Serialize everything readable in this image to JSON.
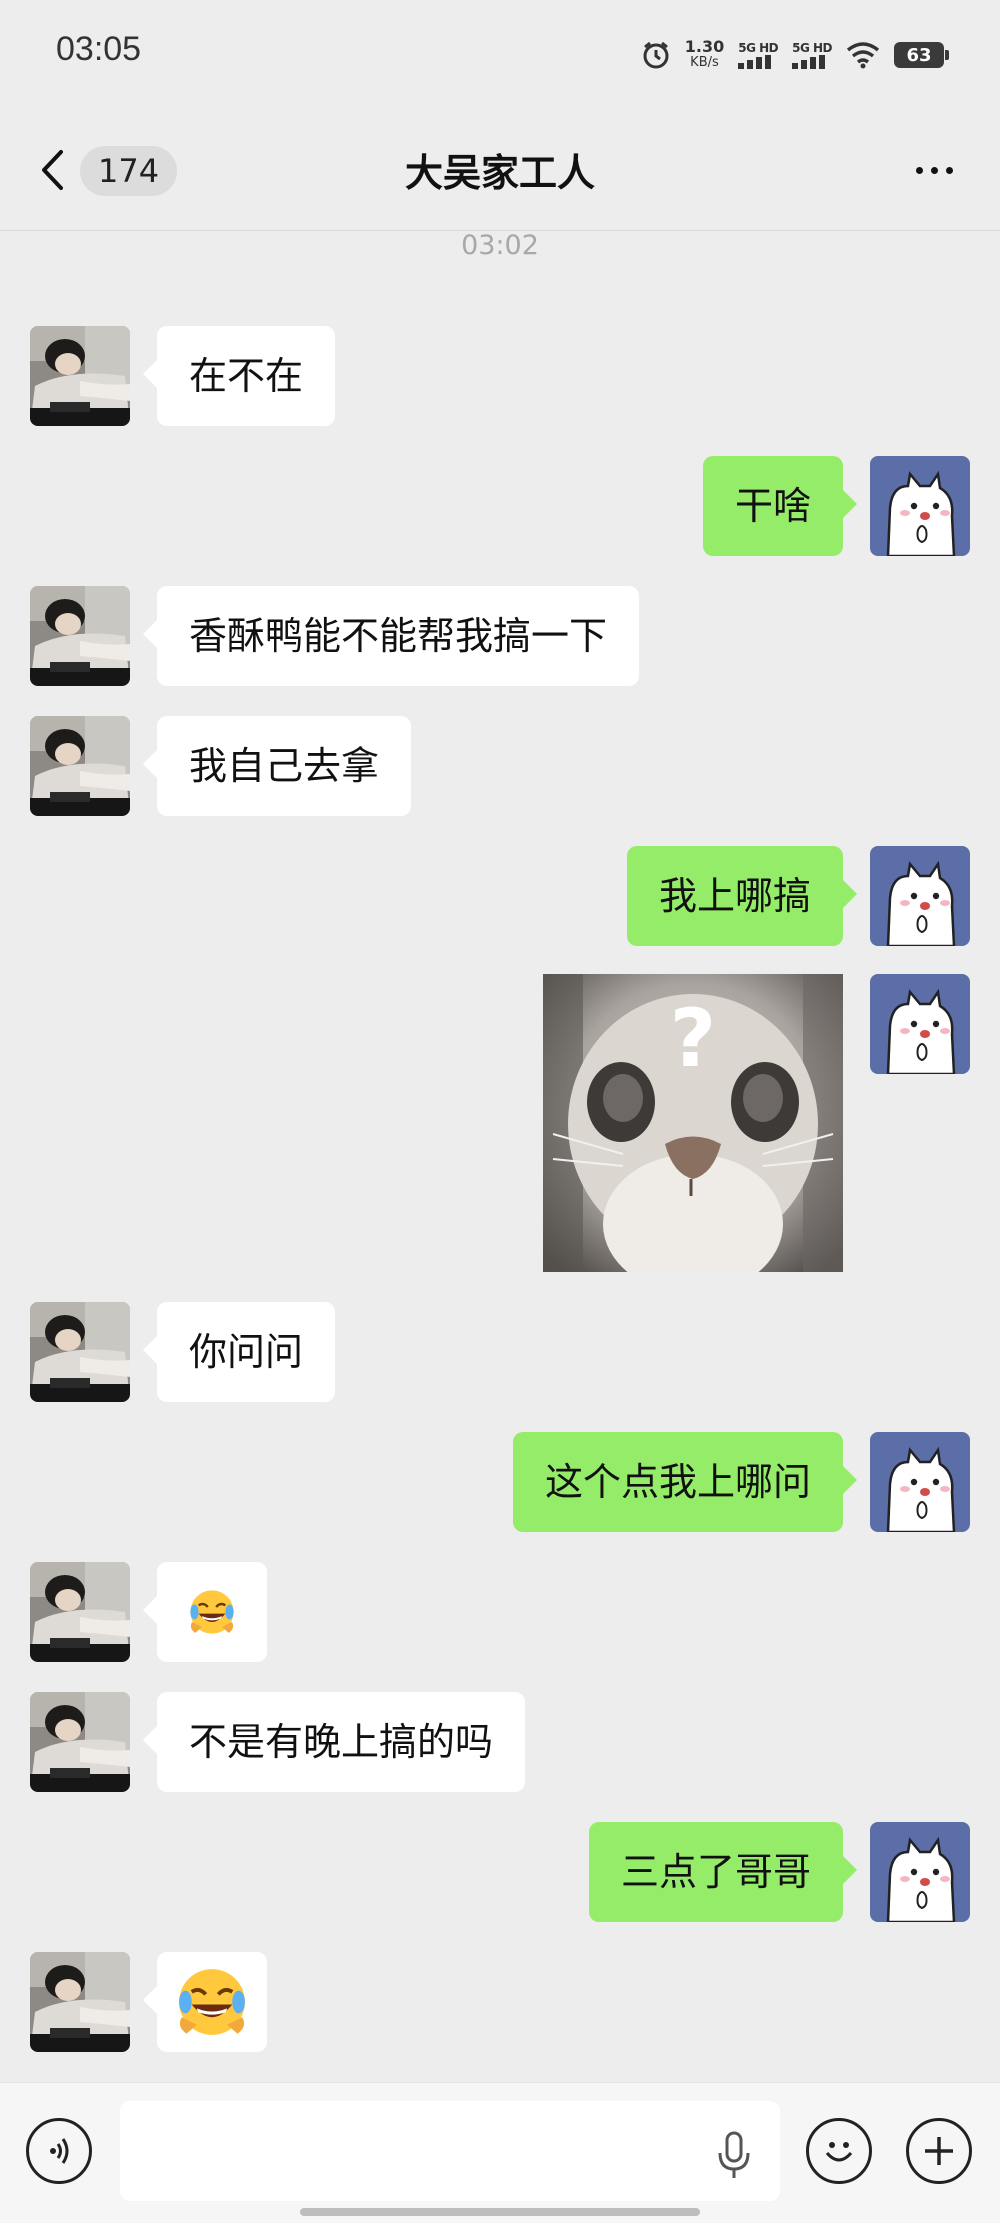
{
  "status_bar": {
    "time": "03:05",
    "net_speed_value": "1.30",
    "net_speed_unit": "KB/s",
    "sim1": "5G HD",
    "sim2": "5G HD",
    "battery": "63"
  },
  "header": {
    "unread_count": "174",
    "title": "大吴家工人"
  },
  "timestamp": "03:02",
  "messages": [
    {
      "from": "them",
      "text": "在不在"
    },
    {
      "from": "me",
      "text": "干啥"
    },
    {
      "from": "them",
      "text": "香酥鸭能不能帮我搞一下"
    },
    {
      "from": "them",
      "text": "我自己去拿"
    },
    {
      "from": "me",
      "text": "我上哪搞"
    },
    {
      "from": "me",
      "type": "image",
      "image": "cat-question-sticker",
      "text": "?"
    },
    {
      "from": "them",
      "text": "你问问"
    },
    {
      "from": "me",
      "text": "这个点我上哪问"
    },
    {
      "from": "them",
      "type": "emoji",
      "emoji": "face-with-tears-of-joy"
    },
    {
      "from": "them",
      "text": "不是有晚上搞的吗"
    },
    {
      "from": "me",
      "text": "三点了哥哥"
    },
    {
      "from": "them",
      "type": "emoji",
      "emoji": "face-with-tears-of-joy"
    }
  ],
  "input_bar": {
    "message_value": "",
    "message_placeholder": ""
  }
}
